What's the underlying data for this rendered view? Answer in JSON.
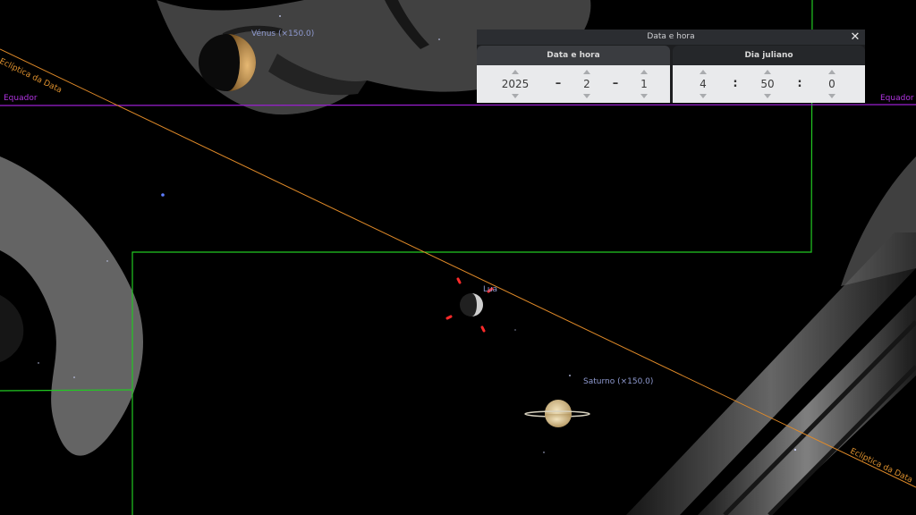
{
  "sky": {
    "labels": {
      "venus": "Vénus (×150.0)",
      "moon": "Lua",
      "saturn": "Saturno (×150.0)",
      "equator_left": "Equador",
      "equator_right": "Equador",
      "ecliptic_top": "Eclíptica da Data",
      "ecliptic_bottom": "Eclíptica da Data"
    },
    "colors": {
      "equator": "#9a1fd0",
      "ecliptic": "#e08a28",
      "boundaries": "#22c922",
      "planet_label": "#8f9ad0",
      "moon_marker": "#ff2a2a"
    }
  },
  "dialog": {
    "title": "Data e hora",
    "close_glyph": "✕",
    "tabs": [
      {
        "label": "Data e hora",
        "active": true
      },
      {
        "label": "Dia juliano",
        "active": false
      }
    ],
    "date": {
      "year": "2025",
      "month": "2",
      "day": "1",
      "separator": "–"
    },
    "time": {
      "hour": "4",
      "minute": "50",
      "second": "0",
      "separator": ":"
    }
  }
}
